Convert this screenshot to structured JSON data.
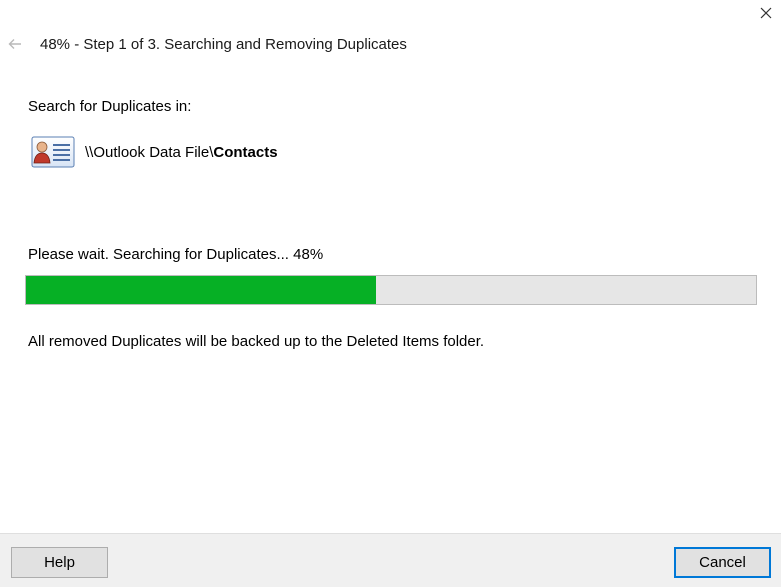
{
  "window": {
    "close_icon": "close-icon"
  },
  "header": {
    "back_icon": "back-arrow-icon",
    "title": "48% - Step 1 of 3. Searching and Removing Duplicates"
  },
  "search": {
    "label": "Search for Duplicates in:",
    "folder_icon": "contacts-folder-icon",
    "folder_path_prefix": "\\\\Outlook Data File\\",
    "folder_name": "Contacts"
  },
  "progress": {
    "label": "Please wait. Searching for Duplicates... 48%",
    "percent": 48,
    "fill_color": "#06b025",
    "track_color": "#e6e6e6"
  },
  "note": {
    "text": "All removed Duplicates will be backed up to the Deleted Items folder."
  },
  "footer": {
    "help_label": "Help",
    "cancel_label": "Cancel",
    "focus_color": "#0078d7"
  }
}
